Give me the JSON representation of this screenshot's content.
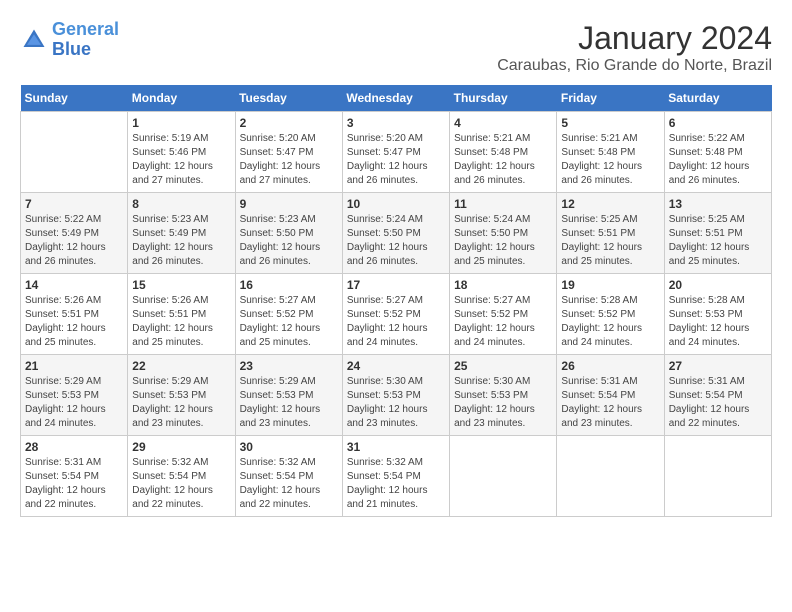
{
  "logo": {
    "line1": "General",
    "line2": "Blue"
  },
  "title": "January 2024",
  "subtitle": "Caraubas, Rio Grande do Norte, Brazil",
  "headers": [
    "Sunday",
    "Monday",
    "Tuesday",
    "Wednesday",
    "Thursday",
    "Friday",
    "Saturday"
  ],
  "weeks": [
    [
      {
        "day": "",
        "info": ""
      },
      {
        "day": "1",
        "info": "Sunrise: 5:19 AM\nSunset: 5:46 PM\nDaylight: 12 hours\nand 27 minutes."
      },
      {
        "day": "2",
        "info": "Sunrise: 5:20 AM\nSunset: 5:47 PM\nDaylight: 12 hours\nand 27 minutes."
      },
      {
        "day": "3",
        "info": "Sunrise: 5:20 AM\nSunset: 5:47 PM\nDaylight: 12 hours\nand 26 minutes."
      },
      {
        "day": "4",
        "info": "Sunrise: 5:21 AM\nSunset: 5:48 PM\nDaylight: 12 hours\nand 26 minutes."
      },
      {
        "day": "5",
        "info": "Sunrise: 5:21 AM\nSunset: 5:48 PM\nDaylight: 12 hours\nand 26 minutes."
      },
      {
        "day": "6",
        "info": "Sunrise: 5:22 AM\nSunset: 5:48 PM\nDaylight: 12 hours\nand 26 minutes."
      }
    ],
    [
      {
        "day": "7",
        "info": "Sunrise: 5:22 AM\nSunset: 5:49 PM\nDaylight: 12 hours\nand 26 minutes."
      },
      {
        "day": "8",
        "info": "Sunrise: 5:23 AM\nSunset: 5:49 PM\nDaylight: 12 hours\nand 26 minutes."
      },
      {
        "day": "9",
        "info": "Sunrise: 5:23 AM\nSunset: 5:50 PM\nDaylight: 12 hours\nand 26 minutes."
      },
      {
        "day": "10",
        "info": "Sunrise: 5:24 AM\nSunset: 5:50 PM\nDaylight: 12 hours\nand 26 minutes."
      },
      {
        "day": "11",
        "info": "Sunrise: 5:24 AM\nSunset: 5:50 PM\nDaylight: 12 hours\nand 25 minutes."
      },
      {
        "day": "12",
        "info": "Sunrise: 5:25 AM\nSunset: 5:51 PM\nDaylight: 12 hours\nand 25 minutes."
      },
      {
        "day": "13",
        "info": "Sunrise: 5:25 AM\nSunset: 5:51 PM\nDaylight: 12 hours\nand 25 minutes."
      }
    ],
    [
      {
        "day": "14",
        "info": "Sunrise: 5:26 AM\nSunset: 5:51 PM\nDaylight: 12 hours\nand 25 minutes."
      },
      {
        "day": "15",
        "info": "Sunrise: 5:26 AM\nSunset: 5:51 PM\nDaylight: 12 hours\nand 25 minutes."
      },
      {
        "day": "16",
        "info": "Sunrise: 5:27 AM\nSunset: 5:52 PM\nDaylight: 12 hours\nand 25 minutes."
      },
      {
        "day": "17",
        "info": "Sunrise: 5:27 AM\nSunset: 5:52 PM\nDaylight: 12 hours\nand 24 minutes."
      },
      {
        "day": "18",
        "info": "Sunrise: 5:27 AM\nSunset: 5:52 PM\nDaylight: 12 hours\nand 24 minutes."
      },
      {
        "day": "19",
        "info": "Sunrise: 5:28 AM\nSunset: 5:52 PM\nDaylight: 12 hours\nand 24 minutes."
      },
      {
        "day": "20",
        "info": "Sunrise: 5:28 AM\nSunset: 5:53 PM\nDaylight: 12 hours\nand 24 minutes."
      }
    ],
    [
      {
        "day": "21",
        "info": "Sunrise: 5:29 AM\nSunset: 5:53 PM\nDaylight: 12 hours\nand 24 minutes."
      },
      {
        "day": "22",
        "info": "Sunrise: 5:29 AM\nSunset: 5:53 PM\nDaylight: 12 hours\nand 23 minutes."
      },
      {
        "day": "23",
        "info": "Sunrise: 5:29 AM\nSunset: 5:53 PM\nDaylight: 12 hours\nand 23 minutes."
      },
      {
        "day": "24",
        "info": "Sunrise: 5:30 AM\nSunset: 5:53 PM\nDaylight: 12 hours\nand 23 minutes."
      },
      {
        "day": "25",
        "info": "Sunrise: 5:30 AM\nSunset: 5:53 PM\nDaylight: 12 hours\nand 23 minutes."
      },
      {
        "day": "26",
        "info": "Sunrise: 5:31 AM\nSunset: 5:54 PM\nDaylight: 12 hours\nand 23 minutes."
      },
      {
        "day": "27",
        "info": "Sunrise: 5:31 AM\nSunset: 5:54 PM\nDaylight: 12 hours\nand 22 minutes."
      }
    ],
    [
      {
        "day": "28",
        "info": "Sunrise: 5:31 AM\nSunset: 5:54 PM\nDaylight: 12 hours\nand 22 minutes."
      },
      {
        "day": "29",
        "info": "Sunrise: 5:32 AM\nSunset: 5:54 PM\nDaylight: 12 hours\nand 22 minutes."
      },
      {
        "day": "30",
        "info": "Sunrise: 5:32 AM\nSunset: 5:54 PM\nDaylight: 12 hours\nand 22 minutes."
      },
      {
        "day": "31",
        "info": "Sunrise: 5:32 AM\nSunset: 5:54 PM\nDaylight: 12 hours\nand 21 minutes."
      },
      {
        "day": "",
        "info": ""
      },
      {
        "day": "",
        "info": ""
      },
      {
        "day": "",
        "info": ""
      }
    ]
  ]
}
